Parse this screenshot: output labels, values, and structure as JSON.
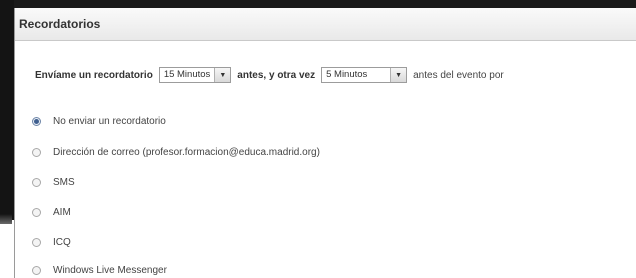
{
  "section": {
    "title": "Recordatorios"
  },
  "reminder": {
    "label_prefix": "Envíame un recordatorio",
    "first_select_value": "15 Minutos",
    "label_middle": "antes, y otra vez",
    "second_select_value": "5 Minutos",
    "label_suffix": "antes del evento por"
  },
  "options": [
    {
      "label": "No enviar un recordatorio",
      "selected": true
    },
    {
      "label": "Dirección de correo (profesor.formacion@educa.madrid.org)",
      "selected": false
    },
    {
      "label": "SMS",
      "selected": false
    },
    {
      "label": "AIM",
      "selected": false
    },
    {
      "label": "ICQ",
      "selected": false
    },
    {
      "label": "Windows Live Messenger",
      "selected": false
    }
  ],
  "icons": {
    "dropdown": "chevron-down-icon"
  }
}
